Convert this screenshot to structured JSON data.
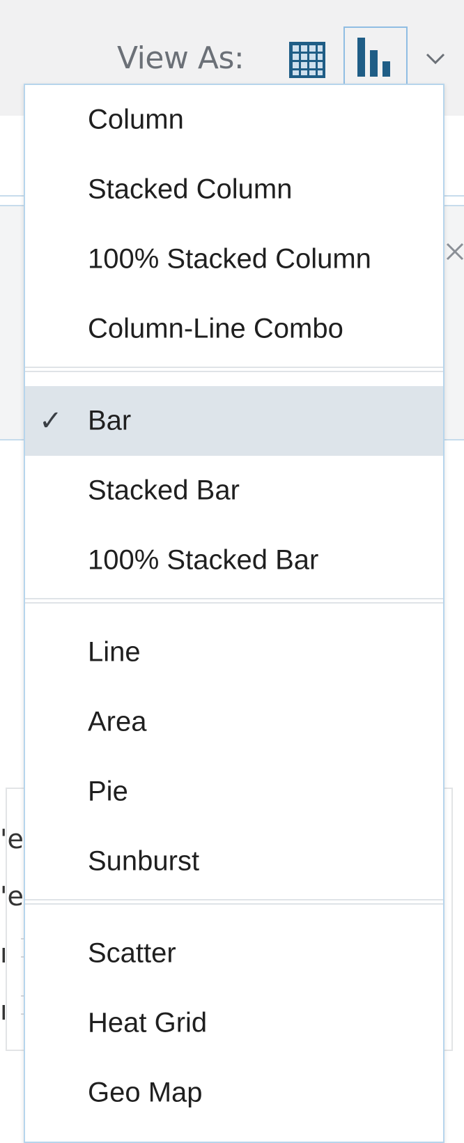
{
  "toolbar": {
    "view_as_label": "View As:",
    "grid_icon": "table-grid-icon",
    "chart_icon": "bar-chart-icon",
    "chevron_icon": "chevron-down-icon",
    "accent_color": "#1f5d86"
  },
  "background": {
    "fragments": [
      "'e",
      "'e",
      "ı",
      "ı"
    ]
  },
  "dropdown": {
    "groups": [
      {
        "items": [
          {
            "label": "Column",
            "selected": false
          },
          {
            "label": "Stacked Column",
            "selected": false
          },
          {
            "label": "100% Stacked Column",
            "selected": false
          },
          {
            "label": "Column-Line Combo",
            "selected": false
          }
        ]
      },
      {
        "items": [
          {
            "label": "Bar",
            "selected": true
          },
          {
            "label": "Stacked Bar",
            "selected": false
          },
          {
            "label": "100% Stacked Bar",
            "selected": false
          }
        ]
      },
      {
        "items": [
          {
            "label": "Line",
            "selected": false
          },
          {
            "label": "Area",
            "selected": false
          },
          {
            "label": "Pie",
            "selected": false
          },
          {
            "label": "Sunburst",
            "selected": false
          }
        ]
      },
      {
        "items": [
          {
            "label": "Scatter",
            "selected": false
          },
          {
            "label": "Heat Grid",
            "selected": false
          },
          {
            "label": "Geo Map",
            "selected": false
          }
        ]
      }
    ],
    "check_glyph": "✓"
  }
}
